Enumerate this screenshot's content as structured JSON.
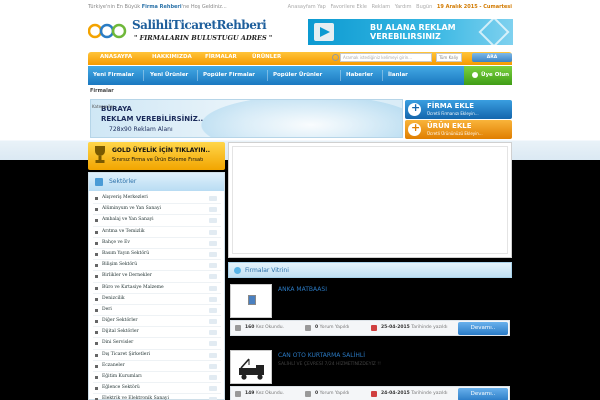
{
  "topbar": {
    "welcome_pre": "Türkiye'nin En Büyük ",
    "welcome_brand": "Firma Rehberi",
    "welcome_post": "'ne Hoş Geldiniz...",
    "links": [
      "Anasayfam Yap",
      "Favorilere Ekle",
      "Reklam",
      "Yardım",
      "Bugün"
    ],
    "date": "19 Aralık 2015 - Cumartesi"
  },
  "logo": {
    "brand": "SalihliTicaretRehberi",
    "slogan": "\" FIRMALARIN BULUSTUGU ADRES \""
  },
  "top_ad": {
    "line1": "BU ALANA REKLAM",
    "line2": "VEREBILIRSINIZ"
  },
  "nav1": [
    "ANASAYFA",
    "HAKKIMIZDA",
    "FİRMALAR",
    "ÜRÜNLER"
  ],
  "search": {
    "placeholder": "Aramak istediğiniz kelimeyi girin...",
    "select": "Tüm Kaliy",
    "button": "ARA"
  },
  "nav2": [
    "Yeni Firmalar",
    "Yeni Ürünler",
    "Popüler Firmalar",
    "Popüler Ürünler",
    "Haberler",
    "İlanlar"
  ],
  "member_label": "Üye Olun",
  "firmalar_label": "Firmalar",
  "firmalar_sub": "Kategoriler",
  "big_ad": {
    "l1": "BURAYA",
    "l2": "REKLAM VEREBİLİRSİNİZ..",
    "l3": "728x90 Reklam Alanı"
  },
  "firma_ekle": {
    "title": "FİRMA EKLE",
    "sub": "Ücretli Firmanızı Ekleyin..."
  },
  "urun_ekle": {
    "title": "ÜRÜN EKLE",
    "sub": "Ücretli Ürününüzü Ekleyin..."
  },
  "gold": {
    "l1": "GOLD ÜYELİK İÇİN TIKLAYIN..",
    "l2": "Sınırsız Firma ve Ürün Ekleme Fırsatı"
  },
  "sektorler": {
    "title": "Sektörler",
    "items": [
      "Alışveriş Merkezleri",
      "Alüminyum ve Yan Sanayi",
      "Ambalaj ve Yan Sanayi",
      "Arıtma ve Temizlik",
      "Bahçe ve Ev",
      "Basım Yayın Sektörü",
      "Bilişim Sektörü",
      "Birlikler ve Dernekler",
      "Büro ve Kırtasiye Malzeme",
      "Denizcilik",
      "Deri",
      "Diğer Sektörler",
      "Dijital Sektörler",
      "Dini Servisler",
      "Dış Ticaret Şirketleri",
      "Eczaneler",
      "Eğitim Kurumları",
      "Eğlence Sektörü",
      "Elektrik ve Elektronik Sanayi"
    ]
  },
  "vitrin_title": "Firmalar Vitrini",
  "listings": [
    {
      "title": "ANKA MATBAASI",
      "desc": "",
      "views": "160",
      "views_label": "Kez Okundu.",
      "comments": "0",
      "comments_label": "Yorum Yapıldı",
      "date": "25-04-2015",
      "date_label": "Tarihinde yazıldı",
      "button": "Devamı.."
    },
    {
      "title": "CAN OTO KURTARMA SALİHLİ",
      "desc": "SALİHLİ VE ÇEVRESİ 7/24 HİZMETİNİZDEYİZ !!",
      "views": "149",
      "views_label": "Kez Okundu.",
      "comments": "0",
      "comments_label": "Yorum Yapıldı",
      "date": "24-04-2015",
      "date_label": "Tarihinde yazıldı",
      "button": "Devamı.."
    }
  ]
}
